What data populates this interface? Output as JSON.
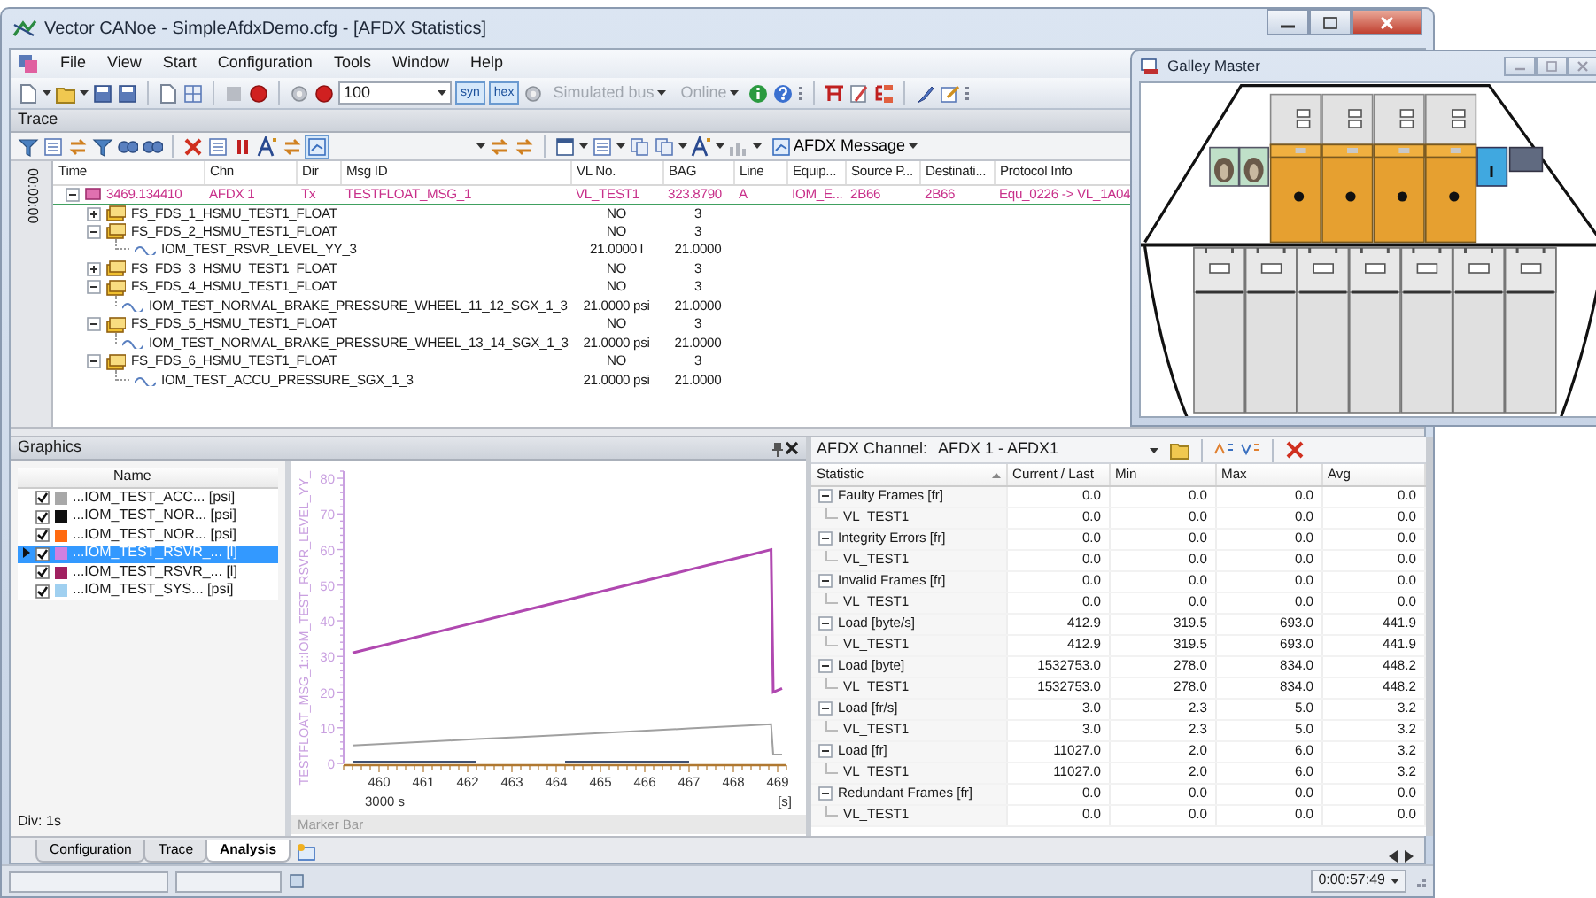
{
  "window": {
    "title": "Vector CANoe - SimpleAfdxDemo.cfg - [AFDX Statistics]"
  },
  "menu": [
    "File",
    "View",
    "Start",
    "Configuration",
    "Tools",
    "Window",
    "Help"
  ],
  "toolbar": {
    "zoom": "100",
    "toggles": [
      {
        "label": "syn",
        "pressed": true
      },
      {
        "label": "hex",
        "pressed": true
      }
    ],
    "menus": [
      {
        "label": "Simulated bus",
        "disabled": true
      },
      {
        "label": "Online",
        "disabled": true
      }
    ]
  },
  "trace": {
    "title": "Trace",
    "view_menu": "AFDX Message",
    "time_gutter": "00:00:00",
    "columns": [
      "Time",
      "Chn",
      "Dir",
      "Msg ID",
      "VL No.",
      "BAG",
      "Line",
      "Equip...",
      "Source P...",
      "Destinati...",
      "Protocol Info"
    ],
    "rows": [
      {
        "selected": true,
        "expanded": true,
        "cells": [
          "3469.134410",
          "AFDX 1",
          "Tx",
          "TESTFLOAT_MSG_1",
          "VL_TEST1",
          "323.8790",
          "A",
          "IOM_E...",
          "2B66",
          "2B66",
          "Equ_0226 -> VL_1A04"
        ],
        "children": [
          {
            "name": "FS_FDS_1_HSMU_TEST1_FLOAT",
            "values": [
              "NO",
              "3"
            ],
            "expanded": false
          },
          {
            "name": "FS_FDS_2_HSMU_TEST1_FLOAT",
            "values": [
              "NO",
              "3"
            ],
            "expanded": true,
            "children": [
              {
                "name": "IOM_TEST_RSVR_LEVEL_YY_3",
                "values": [
                  "21.0000 l",
                  "21.0000"
                ]
              }
            ]
          },
          {
            "name": "FS_FDS_3_HSMU_TEST1_FLOAT",
            "values": [
              "NO",
              "3"
            ],
            "expanded": false
          },
          {
            "name": "FS_FDS_4_HSMU_TEST1_FLOAT",
            "values": [
              "NO",
              "3"
            ],
            "expanded": true,
            "children": [
              {
                "name": "IOM_TEST_NORMAL_BRAKE_PRESSURE_WHEEL_11_12_SGX_1_3",
                "values": [
                  "21.0000 psi",
                  "21.0000"
                ]
              }
            ]
          },
          {
            "name": "FS_FDS_5_HSMU_TEST1_FLOAT",
            "values": [
              "NO",
              "3"
            ],
            "expanded": true,
            "children": [
              {
                "name": "IOM_TEST_NORMAL_BRAKE_PRESSURE_WHEEL_13_14_SGX_1_3",
                "values": [
                  "21.0000 psi",
                  "21.0000"
                ]
              }
            ]
          },
          {
            "name": "FS_FDS_6_HSMU_TEST1_FLOAT",
            "values": [
              "NO",
              "3"
            ],
            "expanded": true,
            "children": [
              {
                "name": "IOM_TEST_ACCU_PRESSURE_SGX_1_3",
                "values": [
                  "21.0000 psi",
                  "21.0000"
                ]
              }
            ]
          }
        ]
      }
    ]
  },
  "graphics": {
    "title": "Graphics",
    "list_header": "Name",
    "division": "Div: 1s",
    "marker_bar": "Marker Bar",
    "signals": [
      {
        "name": "...IOM_TEST_ACC... [psi]",
        "color": "#a8a8a8",
        "checked": true,
        "selected": false
      },
      {
        "name": "...IOM_TEST_NOR... [psi]",
        "color": "#101010",
        "checked": true,
        "selected": false
      },
      {
        "name": "...IOM_TEST_NOR... [psi]",
        "color": "#ff6a10",
        "checked": true,
        "selected": false
      },
      {
        "name": "...IOM_TEST_RSVR_... [l]",
        "color": "#d080e0",
        "checked": true,
        "selected": true
      },
      {
        "name": "...IOM_TEST_RSVR_... [l]",
        "color": "#a02060",
        "checked": true,
        "selected": false
      },
      {
        "name": "...IOM_TEST_SYS... [psi]",
        "color": "#a0d0f0",
        "checked": true,
        "selected": false
      }
    ],
    "chart_data": {
      "type": "line",
      "ylabel": "TESTFLOAT_MSG_1::IOM_TEST_RSVR_LEVEL_YY_",
      "xlabel": "[s]",
      "annotations": [
        {
          "text": "3000 s"
        }
      ],
      "x": [
        459.4,
        462.2,
        463.2,
        464.2,
        467.0,
        468.4,
        468.85,
        468.9,
        469.1
      ],
      "series": [
        {
          "color": "#b048b0",
          "values": [
            31,
            39.6,
            42.7,
            45.7,
            54.3,
            58.6,
            60,
            20,
            21
          ]
        },
        {
          "color": "#a0a0a0",
          "values": [
            5,
            6.8,
            7.4,
            8,
            9.8,
            10.7,
            11,
            2.5,
            2.5
          ]
        },
        {
          "color": "#405070",
          "values": [
            0.5,
            0.5,
            null,
            0.5,
            0.5,
            null,
            null,
            null,
            null
          ]
        }
      ],
      "xlim": [
        459.2,
        469.2
      ],
      "ylim": [
        0,
        82
      ],
      "xticks": [
        460,
        461,
        462,
        463,
        464,
        465,
        466,
        467,
        468,
        469
      ],
      "yticks": [
        0,
        10,
        20,
        30,
        40,
        50,
        60,
        70,
        80
      ]
    }
  },
  "statistics": {
    "channel_label": "AFDX Channel:",
    "channel": "AFDX 1 - AFDX1",
    "columns": [
      "Statistic",
      "Current / Last",
      "Min",
      "Max",
      "Avg"
    ],
    "groups": [
      {
        "name": "Faulty Frames [fr]",
        "expanded": true,
        "values": [
          "0.0",
          "0.0",
          "0.0",
          "0.0"
        ],
        "children": [
          {
            "name": "VL_TEST1",
            "values": [
              "0.0",
              "0.0",
              "0.0",
              "0.0"
            ]
          }
        ]
      },
      {
        "name": "Integrity Errors [fr]",
        "expanded": true,
        "values": [
          "0.0",
          "0.0",
          "0.0",
          "0.0"
        ],
        "children": [
          {
            "name": "VL_TEST1",
            "values": [
              "0.0",
              "0.0",
              "0.0",
              "0.0"
            ]
          }
        ]
      },
      {
        "name": "Invalid Frames [fr]",
        "expanded": true,
        "values": [
          "0.0",
          "0.0",
          "0.0",
          "0.0"
        ],
        "children": [
          {
            "name": "VL_TEST1",
            "values": [
              "0.0",
              "0.0",
              "0.0",
              "0.0"
            ]
          }
        ]
      },
      {
        "name": "Load [byte/s]",
        "expanded": true,
        "values": [
          "412.9",
          "319.5",
          "693.0",
          "441.9"
        ],
        "children": [
          {
            "name": "VL_TEST1",
            "values": [
              "412.9",
              "319.5",
              "693.0",
              "441.9"
            ]
          }
        ]
      },
      {
        "name": "Load [byte]",
        "expanded": true,
        "values": [
          "1532753.0",
          "278.0",
          "834.0",
          "448.2"
        ],
        "children": [
          {
            "name": "VL_TEST1",
            "values": [
              "1532753.0",
              "278.0",
              "834.0",
              "448.2"
            ]
          }
        ]
      },
      {
        "name": "Load [fr/s]",
        "expanded": true,
        "values": [
          "3.0",
          "2.3",
          "5.0",
          "3.2"
        ],
        "children": [
          {
            "name": "VL_TEST1",
            "values": [
              "3.0",
              "2.3",
              "5.0",
              "3.2"
            ]
          }
        ]
      },
      {
        "name": "Load [fr]",
        "expanded": true,
        "values": [
          "11027.0",
          "2.0",
          "6.0",
          "3.2"
        ],
        "children": [
          {
            "name": "VL_TEST1",
            "values": [
              "11027.0",
              "2.0",
              "6.0",
              "3.2"
            ]
          }
        ]
      },
      {
        "name": "Redundant Frames [fr]",
        "expanded": true,
        "values": [
          "0.0",
          "0.0",
          "0.0",
          "0.0"
        ],
        "children": [
          {
            "name": "VL_TEST1",
            "values": [
              "0.0",
              "0.0",
              "0.0",
              "0.0"
            ]
          }
        ]
      }
    ]
  },
  "tabs": [
    {
      "label": "Configuration",
      "selected": false
    },
    {
      "label": "Trace",
      "selected": false
    },
    {
      "label": "Analysis",
      "selected": true
    }
  ],
  "status_bar": {
    "time": "0:00:57:49"
  },
  "galley": {
    "title": "Galley Master"
  }
}
